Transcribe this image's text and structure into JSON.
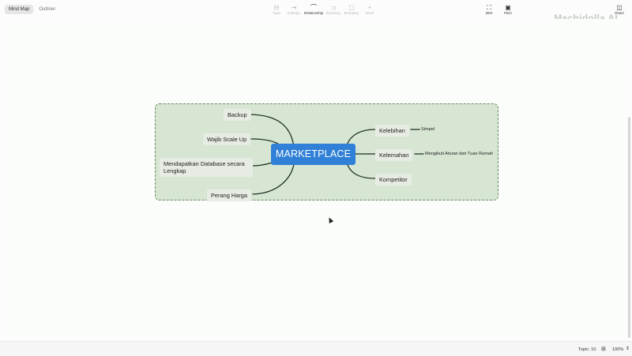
{
  "toolbar": {
    "view_mindmap": "Mind Map",
    "view_outliner": "Outliner",
    "tools": [
      {
        "label": "Topic",
        "icon": "topic-icon",
        "glyph": "⊟"
      },
      {
        "label": "Subtopic",
        "icon": "subtopic-icon",
        "glyph": "⇥"
      },
      {
        "label": "Relationship",
        "icon": "relationship-icon",
        "glyph": "⌒"
      },
      {
        "label": "Summary",
        "icon": "summary-icon",
        "glyph": "⊐"
      },
      {
        "label": "Boundary",
        "icon": "boundary-icon",
        "glyph": "▢"
      },
      {
        "label": "Insert",
        "icon": "insert-icon",
        "glyph": "+"
      }
    ],
    "zen_label": "ZEN",
    "pitch_label": "Pitch",
    "panel_label": "Panel"
  },
  "watermark": "Machidolla AI",
  "mindmap": {
    "central": "MARKETPLACE",
    "left_topics": [
      "Backup",
      "Wajib Scale Up",
      "Mendapatkan Database secara Lengkap",
      "Perang Harga"
    ],
    "right_topics": [
      {
        "label": "Kelebihan",
        "sub": "Simpel"
      },
      {
        "label": "Kelemahan",
        "sub": "Mengikuti Aturan dari Tuan Rumah"
      },
      {
        "label": "Kompetitor",
        "sub": ""
      }
    ]
  },
  "status": {
    "topic_count": "Topic: 10",
    "zoom": "100%"
  },
  "colors": {
    "central": "#2f80d6",
    "boundary_fill": "#d6e6d2",
    "topic_fill": "#e6ece4",
    "branch_line": "#1e2e22"
  }
}
